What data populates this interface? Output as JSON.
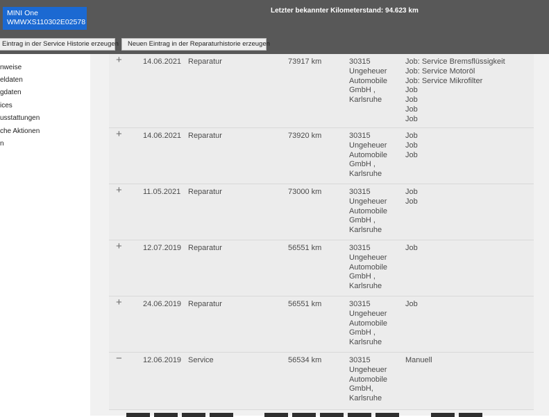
{
  "header": {
    "vehicle_model": "MINI One",
    "vehicle_vin": "WMWXS110302E02578",
    "mileage_text": "Letzter bekannter Kilometerstand: 94.623 km",
    "btn_service": "Eintrag in der Service Historie erzeugen",
    "btn_repair": "Neuen Eintrag in der Reparaturhistorie erzeugen"
  },
  "sidebar": {
    "items": [
      {
        "label": "nweise"
      },
      {
        "label": "eldaten"
      },
      {
        "label": "gdaten"
      },
      {
        "label": "ices"
      },
      {
        "label": "usstattungen"
      },
      {
        "label": "che Aktionen"
      },
      {
        "label": "n"
      }
    ]
  },
  "entries": [
    {
      "toggle": "+",
      "date": "14.06.2021",
      "type": "Reparatur",
      "km": "73917 km",
      "workshop": [
        "30315",
        "Ungeheuer",
        "Automobile",
        "GmbH ,",
        "Karlsruhe"
      ],
      "jobs": [
        "Job: Service Bremsflüssigkeit",
        "Job: Service Motoröl",
        "Job: Service Mikrofilter",
        "Job",
        "Job",
        "Job",
        "Job"
      ]
    },
    {
      "toggle": "+",
      "date": "14.06.2021",
      "type": "Reparatur",
      "km": "73920 km",
      "workshop": [
        "30315",
        "Ungeheuer",
        "Automobile",
        "GmbH ,",
        "Karlsruhe"
      ],
      "jobs": [
        "Job",
        "Job",
        "Job"
      ]
    },
    {
      "toggle": "+",
      "date": "11.05.2021",
      "type": "Reparatur",
      "km": "73000 km",
      "workshop": [
        "30315",
        "Ungeheuer",
        "Automobile",
        "GmbH ,",
        "Karlsruhe"
      ],
      "jobs": [
        "Job",
        "Job"
      ]
    },
    {
      "toggle": "+",
      "date": "12.07.2019",
      "type": "Reparatur",
      "km": "56551 km",
      "workshop": [
        "30315",
        "Ungeheuer",
        "Automobile",
        "GmbH ,",
        "Karlsruhe"
      ],
      "jobs": [
        "Job"
      ]
    },
    {
      "toggle": "+",
      "date": "24.06.2019",
      "type": "Reparatur",
      "km": "56551 km",
      "workshop": [
        "30315",
        "Ungeheuer",
        "Automobile",
        "GmbH ,",
        "Karlsruhe"
      ],
      "jobs": [
        "Job"
      ]
    },
    {
      "toggle": "−",
      "date": "12.06.2019",
      "type": "Service",
      "km": "56534 km",
      "workshop": [
        "30315",
        "Ungeheuer",
        "Automobile",
        "GmbH,",
        "Karlsruhe"
      ],
      "jobs": [
        "Manuell"
      ]
    }
  ]
}
